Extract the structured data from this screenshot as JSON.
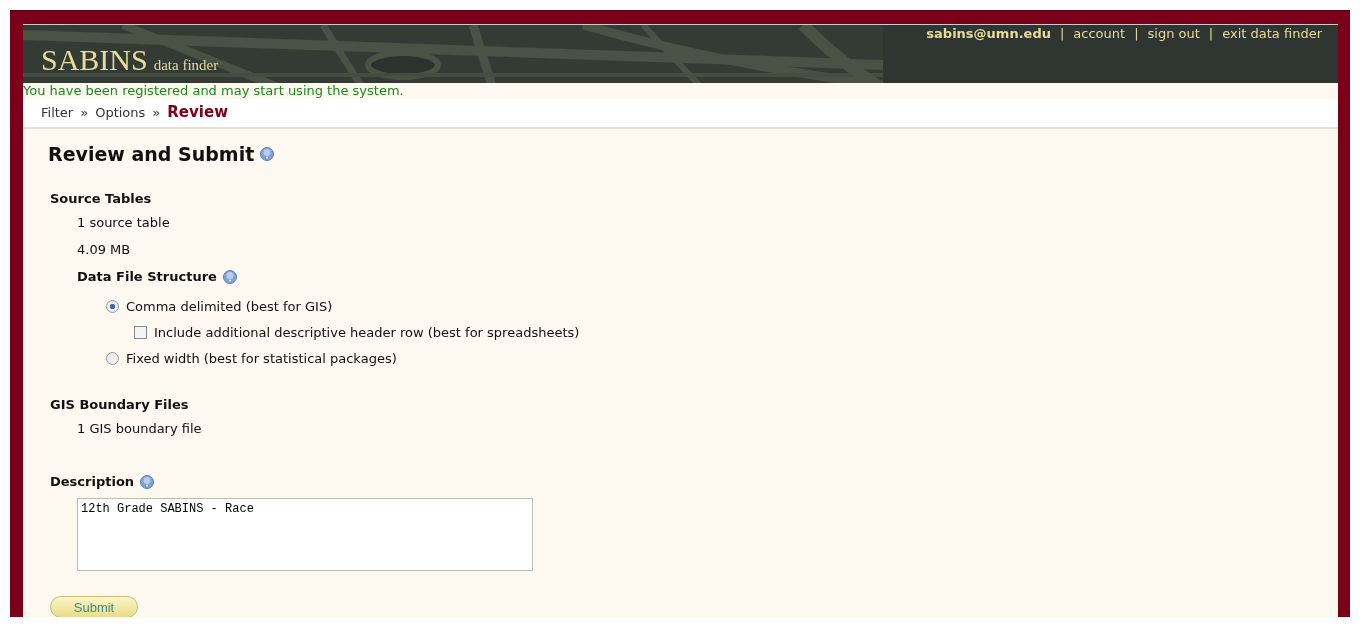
{
  "header": {
    "logo": "SABINS",
    "logo_sub": "data finder",
    "user": "sabins@umn.edu",
    "links": [
      "account",
      "sign out",
      "exit data finder"
    ],
    "separator": "|"
  },
  "message": "You have been registered and may start using the system.",
  "breadcrumb": [
    {
      "label": "Filter",
      "selected": false
    },
    {
      "label": "Options",
      "selected": false
    },
    {
      "label": "Review",
      "selected": true
    }
  ],
  "breadcrumb_separator": "»",
  "title": "Review and Submit",
  "source_tables": {
    "heading": "Source Tables",
    "items": [
      "1 source table",
      "4.09 MB"
    ]
  },
  "data_file_structure": {
    "heading": "Data File Structure",
    "options": [
      {
        "kind": "radio",
        "label": "Comma delimited (best for GIS)",
        "selected": true
      },
      {
        "kind": "checkbox",
        "label": "Include additional descriptive header row (best for spreadsheets)",
        "checked": false
      },
      {
        "kind": "radio",
        "label": "Fixed width (best for statistical packages)",
        "selected": false
      }
    ]
  },
  "gis_boundary_files": {
    "heading": "GIS Boundary Files",
    "items": [
      "1 GIS boundary file"
    ]
  },
  "description": {
    "heading": "Description",
    "value": "12th Grade SABINS - Race"
  },
  "submit": "Submit"
}
